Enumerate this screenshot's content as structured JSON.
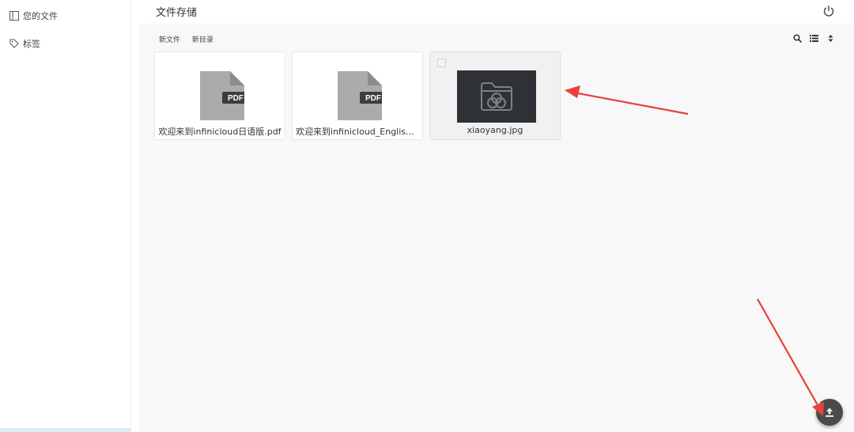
{
  "sidebar": {
    "items": [
      {
        "label": "您的文件",
        "icon": "panel-icon"
      },
      {
        "label": "标签",
        "icon": "tag-icon"
      }
    ]
  },
  "header": {
    "title": "文件存储",
    "power_icon": "power-icon"
  },
  "toolbar": {
    "new_file": "新文件",
    "new_folder": "新目录",
    "icons": [
      "search-icon",
      "list-view-icon",
      "sort-icon"
    ]
  },
  "files": [
    {
      "name": "欢迎来到infinicloud日语版.pdf",
      "type_badge": "PDF",
      "selected": false
    },
    {
      "name": "欢迎来到infinicloud_English.pdf",
      "type_badge": "PDF",
      "selected": false
    },
    {
      "name": "xiaoyang.jpg",
      "type_badge": "",
      "selected": true
    }
  ],
  "upload_icon": "upload-icon",
  "annotation_color": "#e8413d"
}
